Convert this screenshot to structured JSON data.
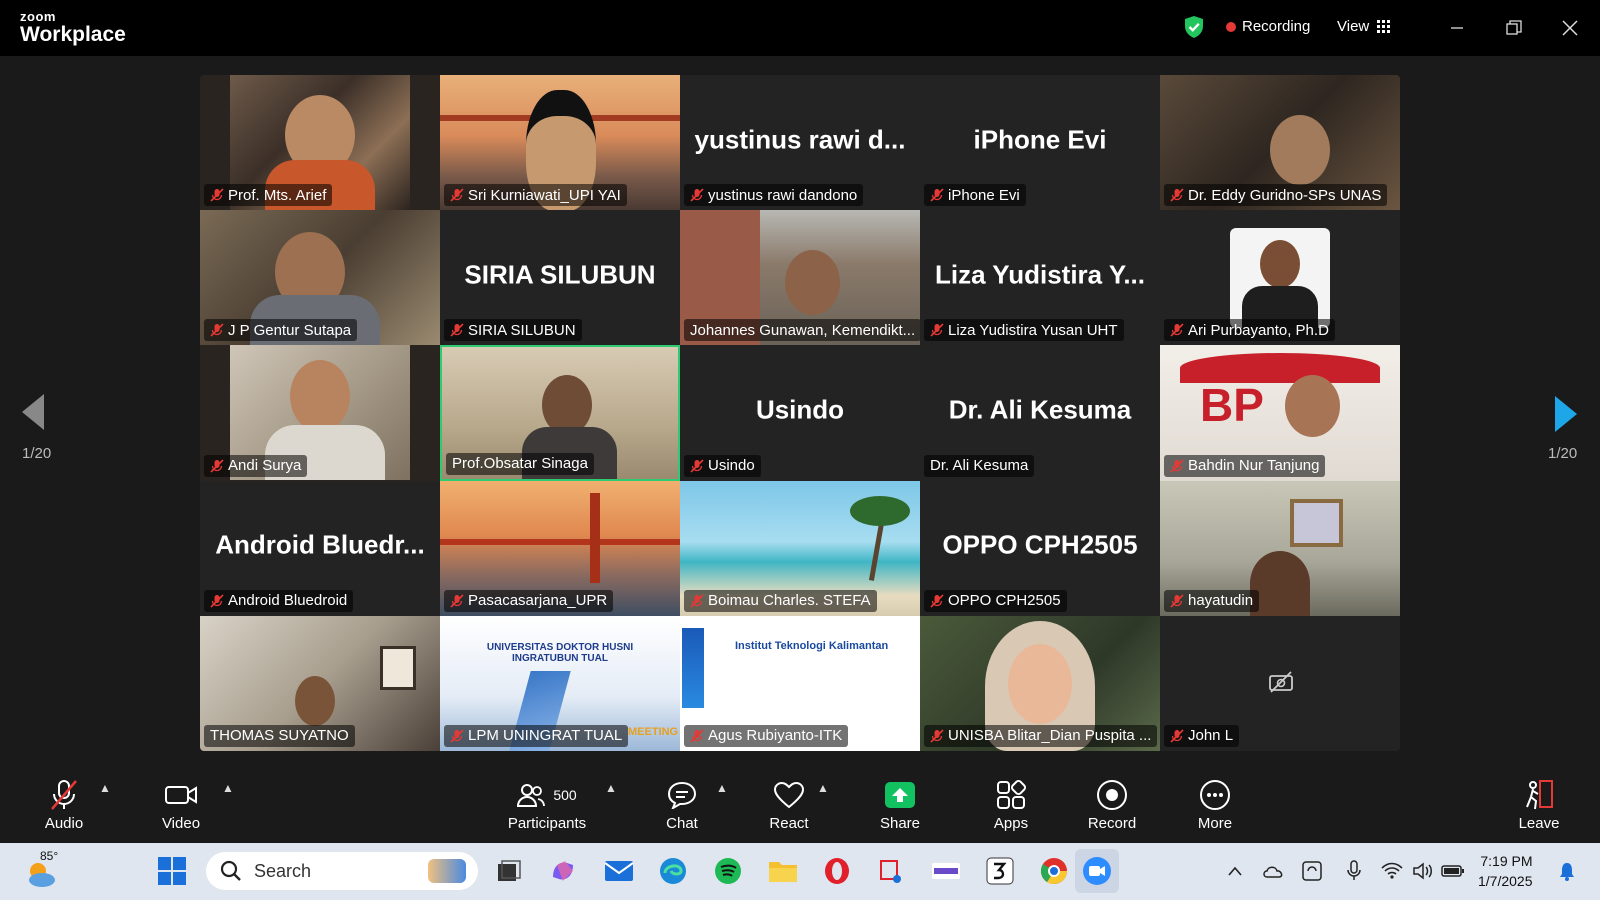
{
  "app": {
    "brand_top": "zoom",
    "brand_bottom": "Workplace",
    "recording": "Recording",
    "view": "View"
  },
  "colors": {
    "accent_green": "#2ecc71",
    "recording_red": "#e53935",
    "share_green": "#12c260",
    "nav_blue": "#1ea7e8"
  },
  "pager": {
    "left": "1/20",
    "right": "1/20"
  },
  "tiles": [
    {
      "name": "Prof. Mts. Arief",
      "big": "",
      "muted": true
    },
    {
      "name": "Sri Kurniawati_UPI YAI",
      "big": "",
      "muted": true
    },
    {
      "name": "yustinus rawi dandono",
      "big": "yustinus rawi d...",
      "muted": true
    },
    {
      "name": "iPhone Evi",
      "big": "iPhone Evi",
      "muted": true
    },
    {
      "name": "Dr. Eddy Guridno-SPs UNAS",
      "big": "",
      "muted": true
    },
    {
      "name": "J P Gentur Sutapa",
      "big": "",
      "muted": true
    },
    {
      "name": "SIRIA SILUBUN",
      "big": "SIRIA SILUBUN",
      "muted": true
    },
    {
      "name": "Johannes Gunawan, Kemendikt...",
      "big": "",
      "muted": false
    },
    {
      "name": "Liza Yudistira Yusan UHT",
      "big": "Liza Yudistira Y...",
      "muted": true
    },
    {
      "name": "Ari Purbayanto, Ph.D",
      "big": "",
      "muted": true
    },
    {
      "name": "Andi Surya",
      "big": "",
      "muted": true
    },
    {
      "name": "Prof.Obsatar Sinaga",
      "big": "",
      "muted": false
    },
    {
      "name": "Usindo",
      "big": "Usindo",
      "muted": true
    },
    {
      "name": "Dr. Ali Kesuma",
      "big": "Dr. Ali Kesuma",
      "muted": false
    },
    {
      "name": "Bahdin Nur Tanjung",
      "big": "",
      "muted": true
    },
    {
      "name": "Android Bluedroid",
      "big": "Android  Bluedr...",
      "muted": true
    },
    {
      "name": "Pasacasarjana_UPR",
      "big": "",
      "muted": true
    },
    {
      "name": "Boimau Charles. STEFA",
      "big": "",
      "muted": true
    },
    {
      "name": "OPPO CPH2505",
      "big": "OPPO CPH2505",
      "muted": true
    },
    {
      "name": "hayatudin",
      "big": "",
      "muted": true
    },
    {
      "name": "THOMAS SUYATNO",
      "big": "",
      "muted": false
    },
    {
      "name": "LPM UNINGRAT TUAL",
      "big": "",
      "muted": true
    },
    {
      "name": "Agus Rubiyanto-ITK",
      "big": "",
      "muted": true
    },
    {
      "name": "UNISBA Blitar_Dian Puspita ...",
      "big": "",
      "muted": true
    },
    {
      "name": "John L",
      "big": "",
      "muted": true
    }
  ],
  "slides": {
    "uningrat": "UNIVERSITAS DOKTOR HUSNI INGRATUBUN TUAL",
    "uningrat_meeting": "MEETING",
    "itk": "Institut Teknologi Kalimantan",
    "asosiasi": "BP"
  },
  "toolbar": {
    "audio": "Audio",
    "video": "Video",
    "participants": "Participants",
    "participants_count": "500",
    "chat": "Chat",
    "react": "React",
    "share": "Share",
    "apps": "Apps",
    "record": "Record",
    "more": "More",
    "leave": "Leave"
  },
  "taskbar": {
    "weather": "85°",
    "search": "Search",
    "time": "7:19 PM",
    "date": "1/7/2025"
  }
}
